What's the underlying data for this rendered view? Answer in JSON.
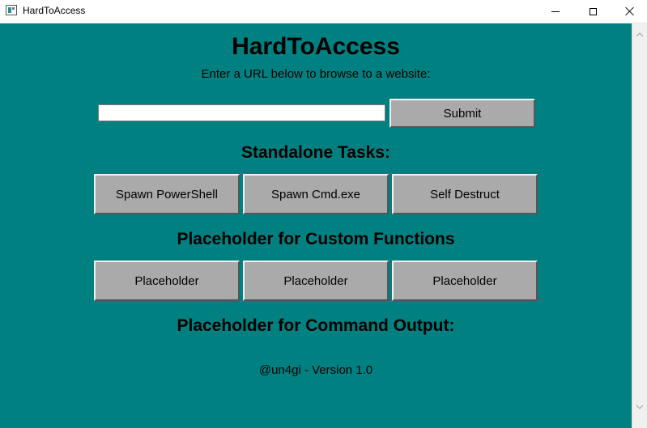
{
  "window": {
    "title": "HardToAccess",
    "controls": [
      "minimize",
      "maximize",
      "close"
    ]
  },
  "app": {
    "title": "HardToAccess",
    "subtitle": "Enter a URL below to browse to a website:",
    "url_input": {
      "value": "",
      "placeholder": ""
    },
    "submit_label": "Submit",
    "standalone_heading": "Standalone Tasks:",
    "standalone_tasks": [
      "Spawn PowerShell",
      "Spawn Cmd.exe",
      "Self Destruct"
    ],
    "custom_heading": "Placeholder for Custom Functions",
    "custom_functions": [
      "Placeholder",
      "Placeholder",
      "Placeholder"
    ],
    "output_heading": "Placeholder for Command Output:",
    "footer": "@un4gi - Version 1.0"
  },
  "colors": {
    "background": "#008080",
    "button": "#aaaaaa",
    "titlebar": "#ffffff"
  },
  "icons": {
    "app": "app-window-icon",
    "scroll_up": "chevron-up-icon",
    "scroll_down": "chevron-down-icon"
  }
}
